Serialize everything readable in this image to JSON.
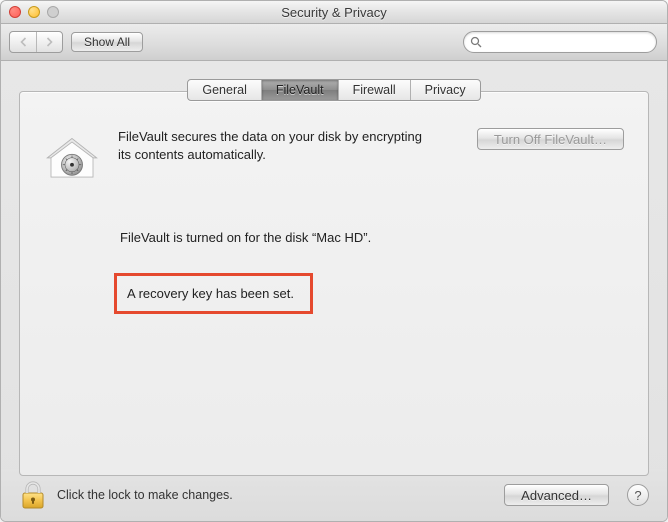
{
  "window": {
    "title": "Security & Privacy"
  },
  "toolbar": {
    "show_all_label": "Show All",
    "search_placeholder": ""
  },
  "tabs": {
    "items": [
      {
        "label": "General"
      },
      {
        "label": "FileVault"
      },
      {
        "label": "Firewall"
      },
      {
        "label": "Privacy"
      }
    ],
    "selected_index": 1
  },
  "filevault": {
    "description": "FileVault secures the data on your disk by encrypting its contents automatically.",
    "turn_off_label": "Turn Off FileVault…",
    "status": "FileVault is turned on for the disk “Mac HD”.",
    "recovery_key": "A recovery key has been set."
  },
  "footer": {
    "lock_text": "Click the lock to make changes.",
    "advanced_label": "Advanced…",
    "help_label": "?"
  },
  "colors": {
    "highlight": "#E5492E"
  }
}
